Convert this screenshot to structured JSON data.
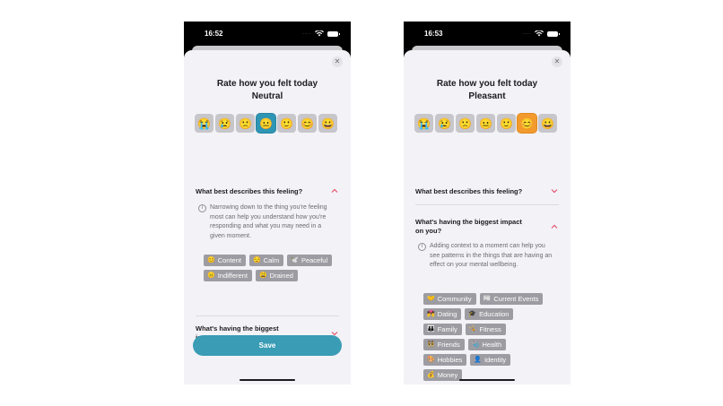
{
  "left": {
    "status_time": "16:52",
    "title_line1": "Rate how you felt today",
    "title_line2": "Neutral",
    "emojis": [
      "😭",
      "😢",
      "🙁",
      "😐",
      "🙂",
      "😊",
      "😀"
    ],
    "selected_index": 3,
    "section1_title": "What best describes this feeling?",
    "section1_info": "Narrowing down to the thing you're feeling most can help you understand how you're responding and what you may need in a given moment.",
    "feelings": [
      {
        "emoji": "😊",
        "label": "Content"
      },
      {
        "emoji": "😌",
        "label": "Calm"
      },
      {
        "emoji": "🕊️",
        "label": "Peaceful"
      },
      {
        "emoji": "😐",
        "label": "Indifferent"
      },
      {
        "emoji": "😩",
        "label": "Drained"
      }
    ],
    "section2_title": "What's having the biggest impact on you?",
    "save_label": "Save"
  },
  "right": {
    "status_time": "16:53",
    "title_line1": "Rate how you felt today",
    "title_line2": "Pleasant",
    "emojis": [
      "😭",
      "😢",
      "🙁",
      "😐",
      "🙂",
      "😊",
      "😀"
    ],
    "selected_index": 5,
    "section1_title": "What best describes this feeling?",
    "section2_title": "What's having the biggest impact on you?",
    "section2_info": "Adding context to a moment can help you see patterns in the things that are having an effect on your mental wellbeing.",
    "impacts": [
      {
        "emoji": "🤝",
        "label": "Community"
      },
      {
        "emoji": "📰",
        "label": "Current Events"
      },
      {
        "emoji": "💏",
        "label": "Dating"
      },
      {
        "emoji": "🎓",
        "label": "Education"
      },
      {
        "emoji": "👪",
        "label": "Family"
      },
      {
        "emoji": "🤸",
        "label": "Fitness"
      },
      {
        "emoji": "👯",
        "label": "Friends"
      },
      {
        "emoji": "🩺",
        "label": "Health"
      },
      {
        "emoji": "🎨",
        "label": "Hobbies"
      },
      {
        "emoji": "👤",
        "label": "Identity"
      },
      {
        "emoji": "💰",
        "label": "Money"
      }
    ]
  },
  "colors": {
    "accent_teal": "#3a9cb5",
    "selected_orange": "#f29a2e",
    "chevron_red": "#e4566b",
    "chip_gray": "#9c9ca2"
  },
  "icons": {
    "close": "close-icon",
    "chevron_up": "chevron-up-icon",
    "chevron_down": "chevron-down-icon",
    "info": "info-icon",
    "wifi": "wifi-icon",
    "battery": "battery-icon"
  }
}
